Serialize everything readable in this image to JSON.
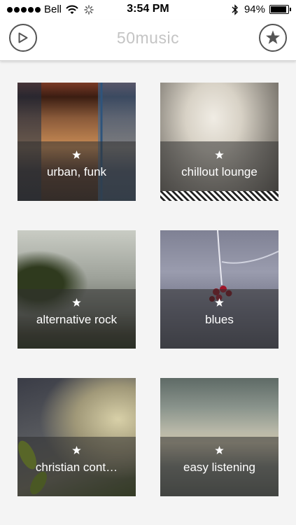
{
  "status_bar": {
    "carrier": "Bell",
    "time": "3:54 PM",
    "battery": "94%"
  },
  "nav": {
    "title": "50music",
    "left_icon": "play-icon",
    "right_icon": "star-icon"
  },
  "genres": [
    {
      "label": "urban, funk",
      "favorite_icon": "star-icon"
    },
    {
      "label": "chillout lounge",
      "favorite_icon": "star-icon"
    },
    {
      "label": "alternative rock",
      "favorite_icon": "star-icon"
    },
    {
      "label": "blues",
      "favorite_icon": "star-icon"
    },
    {
      "label": "christian cont…",
      "favorite_icon": "star-icon"
    },
    {
      "label": "easy listening",
      "favorite_icon": "star-icon"
    }
  ]
}
